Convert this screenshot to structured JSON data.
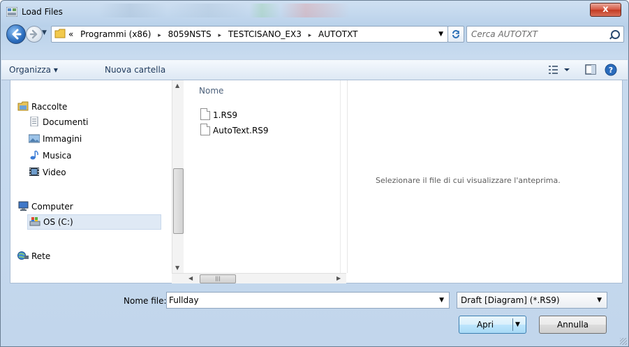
{
  "window": {
    "title": "Load Files",
    "close_label": "x"
  },
  "address": {
    "overflow": "«",
    "crumbs": [
      "Programmi (x86)",
      "8059NSTS",
      "TESTCISANO_EX3",
      "AUTOTXT"
    ],
    "separator": "▸",
    "dropdown": "▼"
  },
  "search": {
    "placeholder": "Cerca AUTOTXT"
  },
  "toolbar": {
    "organize_label": "Organizza ▾",
    "new_folder_label": "Nuova cartella"
  },
  "nav": {
    "items": [
      {
        "label": "Raccolte",
        "icon": "libraries-icon"
      },
      {
        "label": "Documenti",
        "icon": "documents-icon"
      },
      {
        "label": "Immagini",
        "icon": "pictures-icon"
      },
      {
        "label": "Musica",
        "icon": "music-icon"
      },
      {
        "label": "Video",
        "icon": "video-icon"
      },
      {
        "label": "Computer",
        "icon": "computer-icon"
      },
      {
        "label": "OS (C:)",
        "icon": "drive-icon"
      },
      {
        "label": "Rete",
        "icon": "network-icon"
      }
    ]
  },
  "files": {
    "column_header": "Nome",
    "items": [
      "1.RS9",
      "AutoText.RS9"
    ]
  },
  "preview": {
    "message": "Selezionare il file di cui visualizzare l'anteprima."
  },
  "footer": {
    "filename_label": "Nome file:",
    "filename_value": "Fullday",
    "filetype_value": "Draft [Diagram]  (*.RS9)",
    "open_label": "Apri",
    "cancel_label": "Annulla"
  },
  "colors": {
    "window_frame": "#b9d1ea",
    "close_button": "#c33a22",
    "link_text": "#1e395b"
  }
}
